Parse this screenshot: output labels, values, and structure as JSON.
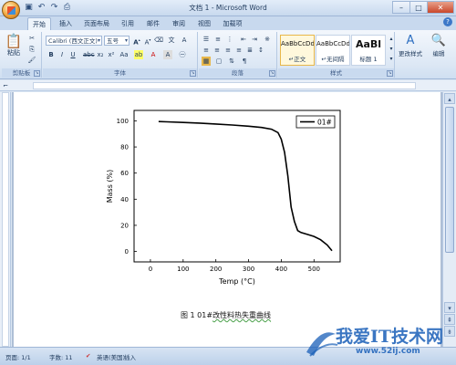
{
  "window": {
    "title": "文档 1 - Microsoft Word"
  },
  "quick_access": [
    "save-icon",
    "undo-icon",
    "redo-icon",
    "print-icon"
  ],
  "tabs": [
    {
      "label": "开始",
      "active": true
    },
    {
      "label": "插入"
    },
    {
      "label": "页面布局"
    },
    {
      "label": "引用"
    },
    {
      "label": "邮件"
    },
    {
      "label": "审阅"
    },
    {
      "label": "视图"
    },
    {
      "label": "加载项"
    }
  ],
  "ribbon": {
    "clipboard": {
      "label": "剪贴板",
      "paste_label": "粘贴"
    },
    "font": {
      "label": "字体",
      "font_name": "Calibri (西文正文)",
      "font_size": "五号"
    },
    "paragraph": {
      "label": "段落"
    },
    "styles": {
      "label": "样式",
      "items": [
        {
          "sample": "AaBbCcDd",
          "name": "↵正文",
          "selected": true
        },
        {
          "sample": "AaBbCcDd",
          "name": "↵无间隔"
        },
        {
          "sample": "AaBl",
          "name": "标题 1"
        }
      ],
      "change_styles_label": "更改样式"
    },
    "editing": {
      "label": "编辑"
    }
  },
  "chart_data": {
    "type": "line",
    "series": [
      {
        "name": "01#",
        "x": [
          25,
          50,
          100,
          150,
          200,
          250,
          300,
          340,
          370,
          390,
          400,
          410,
          420,
          425,
          430,
          440,
          450,
          460,
          480,
          500,
          520,
          540,
          555
        ],
        "y": [
          99.5,
          99.3,
          98.8,
          98.3,
          97.6,
          96.8,
          95.9,
          94.9,
          93.6,
          91.0,
          86.0,
          76.0,
          58.0,
          46.0,
          34.0,
          23.0,
          16.0,
          14.5,
          13.0,
          11.5,
          9.0,
          5.0,
          0.5
        ]
      }
    ],
    "xlabel": "Temp (°C)",
    "ylabel": "Mass (%)",
    "xlim": [
      -50,
      580
    ],
    "ylim": [
      -8,
      108
    ],
    "xticks": [
      0,
      100,
      200,
      300,
      400,
      500
    ],
    "yticks": [
      0,
      20,
      40,
      60,
      80,
      100
    ],
    "grid": false,
    "legend": "top-right"
  },
  "caption": {
    "prefix": "图 1   01#",
    "underlined": "改性料热失重曲线"
  },
  "status": {
    "page": "页面: 1/1",
    "words": "字数: 11",
    "language": "英语(美国)",
    "mode": "插入"
  },
  "watermark": {
    "text": "我爱IT技术网",
    "url": "www.52ij.com"
  },
  "colors": {
    "accent": "#c8d9ee",
    "curve": "#000000",
    "watermark": "#1a5fb8"
  }
}
